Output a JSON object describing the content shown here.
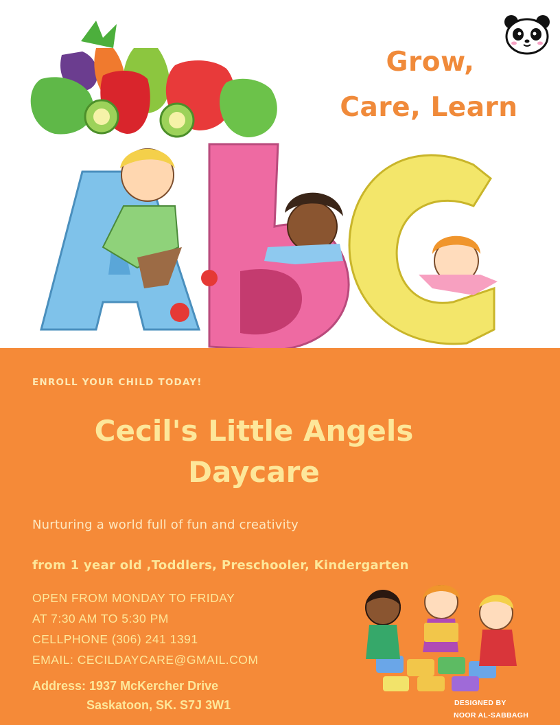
{
  "tagline": {
    "line1": "Grow,",
    "line2": "Care, Learn"
  },
  "enroll_label": "ENROLL YOUR CHILD TODAY!",
  "title": {
    "line1": "Cecil's Little Angels",
    "line2": "Daycare"
  },
  "subtitle": "Nurturing a world full of fun and creativity",
  "ages": "from 1 year old ,Toddlers, Preschooler, Kindergarten",
  "info": {
    "hours_days": "OPEN FROM MONDAY TO FRIDAY",
    "hours_time": "AT  7:30 AM TO 5:30 PM",
    "phone": "CELLPHONE  (306) 241 1391",
    "email": "EMAIL: CECILDAYCARE@GMAIL.COM"
  },
  "address": {
    "line1": "Address: 1937 McKercher Drive",
    "line2": "Saskatoon, SK. S7J 3W1"
  },
  "credit": {
    "line1": "DESIGNED BY",
    "line2": "NOOR AL-SABBAGH"
  },
  "colors": {
    "orange": "#f58a38",
    "title_yellow": "#fde79a",
    "tagline_orange": "#f08a3a"
  },
  "icons": [
    "panda-logo-icon",
    "vegetables-illustration",
    "abc-kids-illustration",
    "puzzle-kids-illustration"
  ]
}
